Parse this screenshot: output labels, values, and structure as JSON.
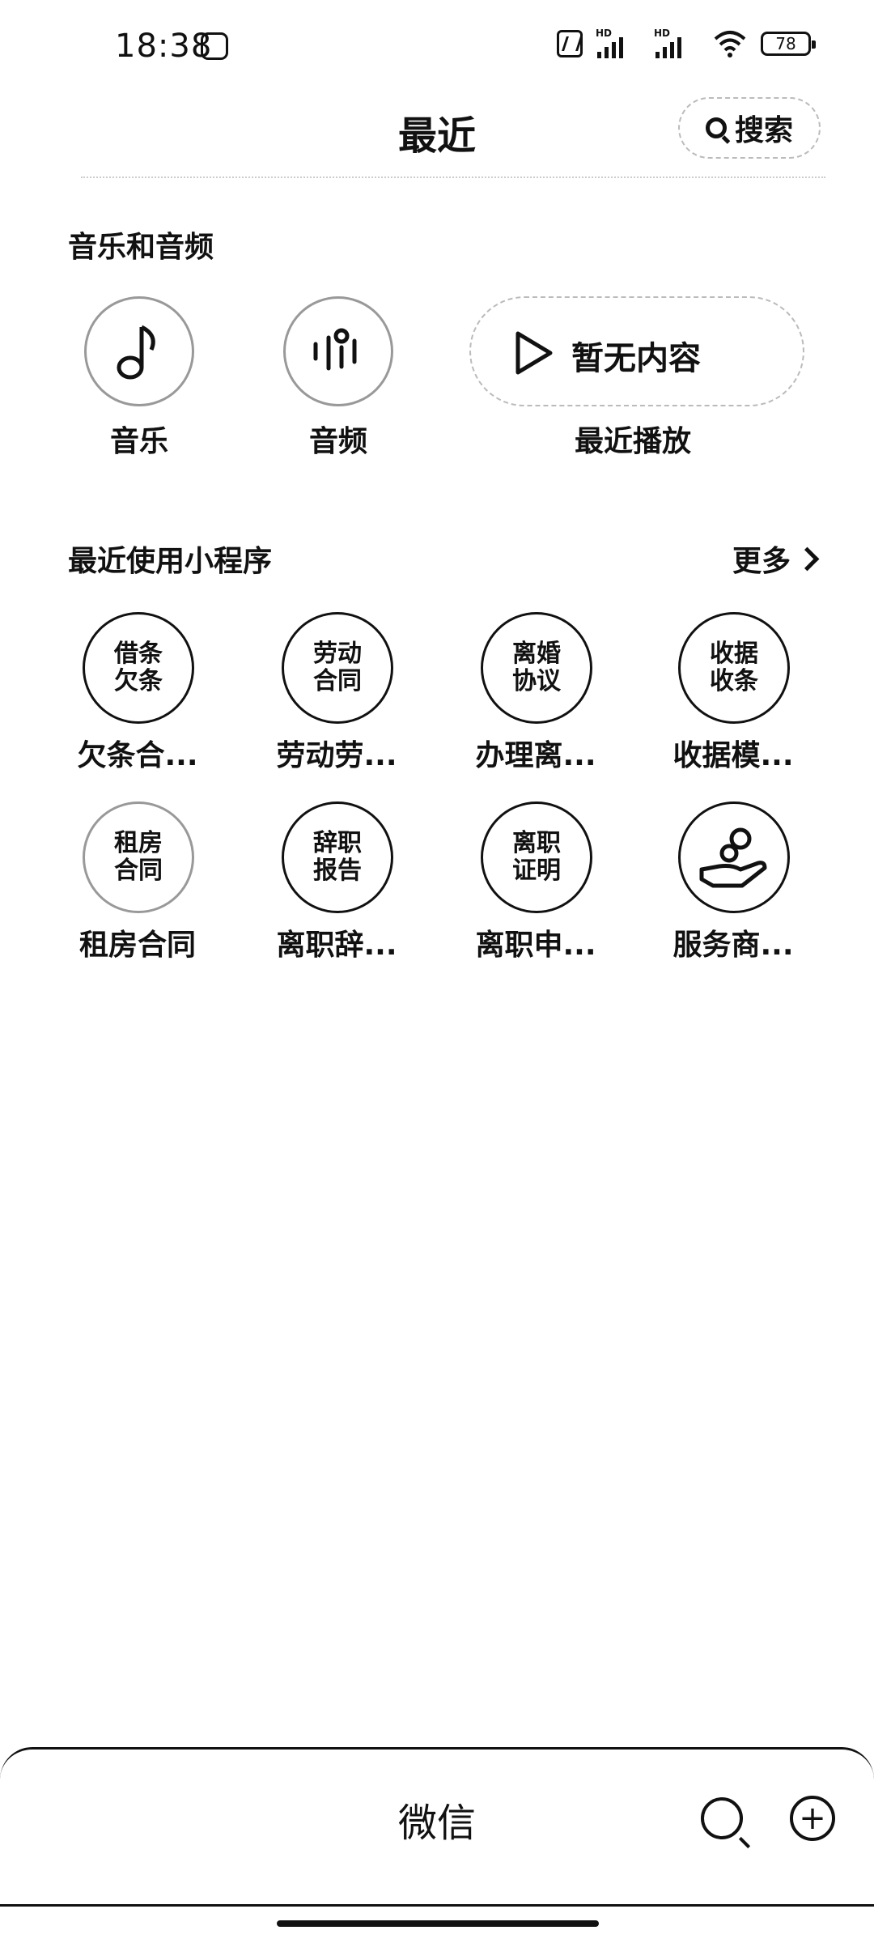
{
  "status_bar": {
    "time": "18:38",
    "hd1": "HD",
    "hd2": "HD",
    "battery": "78"
  },
  "header": {
    "title": "最近",
    "search_label": "搜索"
  },
  "music_section": {
    "title": "音乐和音频",
    "items": [
      {
        "label": "音乐",
        "icon": "music-note-icon"
      },
      {
        "label": "音频",
        "icon": "audio-wave-icon"
      }
    ],
    "recent_play": {
      "label": "最近播放",
      "empty_text": "暂无内容",
      "icon": "play-icon"
    }
  },
  "mini_programs": {
    "title": "最近使用小程序",
    "more_label": "更多",
    "items": [
      {
        "icon_text": "借条欠条",
        "label": "欠条合..."
      },
      {
        "icon_text": "劳动合同",
        "label": "劳动劳..."
      },
      {
        "icon_text": "离婚协议",
        "label": "办理离..."
      },
      {
        "icon_text": "收据收条",
        "label": "收据模..."
      },
      {
        "icon_text": "租房合同",
        "label": "租房合同"
      },
      {
        "icon_text": "辞职报告",
        "label": "离职辞..."
      },
      {
        "icon_text": "离职证明",
        "label": "离职申..."
      },
      {
        "icon_text": "",
        "label": "服务商...",
        "icon": "service-hand-icon"
      }
    ]
  },
  "bottom_bar": {
    "title": "微信"
  }
}
